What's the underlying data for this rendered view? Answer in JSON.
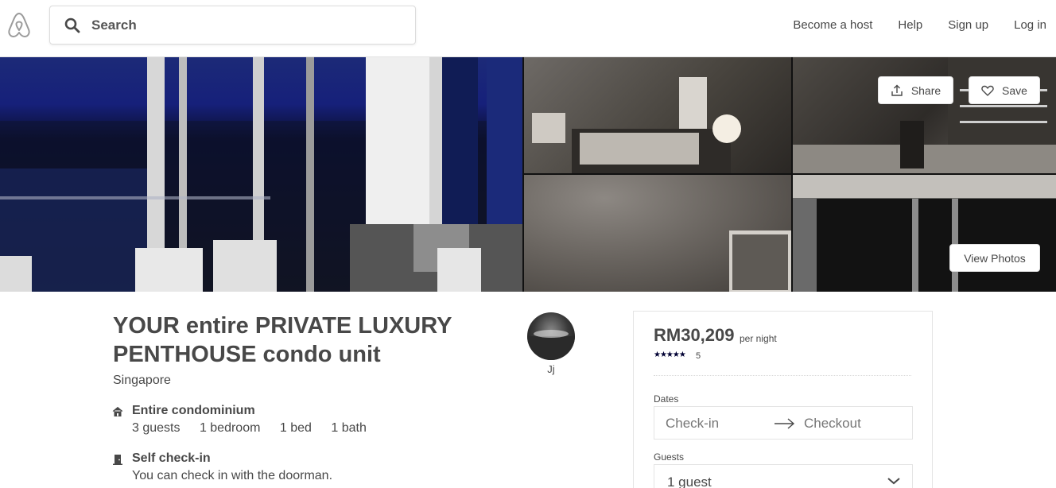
{
  "header": {
    "logo": "airbnb-logo-icon",
    "search_placeholder": "Search",
    "nav": [
      "Become a host",
      "Help",
      "Sign up",
      "Log in"
    ]
  },
  "photos": {
    "share_label": "Share",
    "save_label": "Save",
    "view_label": "View Photos"
  },
  "listing": {
    "title": "YOUR entire PRIVATE LUXURY PENTHOUSE condo unit",
    "location": "Singapore",
    "host_name": "Jj",
    "feature1": {
      "icon": "home-icon",
      "title": "Entire condominium",
      "details": [
        "3 guests",
        "1 bedroom",
        "1 bed",
        "1 bath"
      ]
    },
    "feature2": {
      "icon": "door-icon",
      "title": "Self check-in",
      "subtitle": "You can check in with the doorman."
    }
  },
  "booking": {
    "price": "RM30,209",
    "per_night": "per night",
    "stars": "★★★★★",
    "rating": 5,
    "review_count": "5",
    "dates_label": "Dates",
    "checkin_placeholder": "Check-in",
    "checkout_placeholder": "Checkout",
    "guests_label": "Guests",
    "guests_value": "1 guest"
  },
  "colors": {
    "text": "#484848",
    "star": "#000033",
    "border": "#e4e4e4"
  }
}
